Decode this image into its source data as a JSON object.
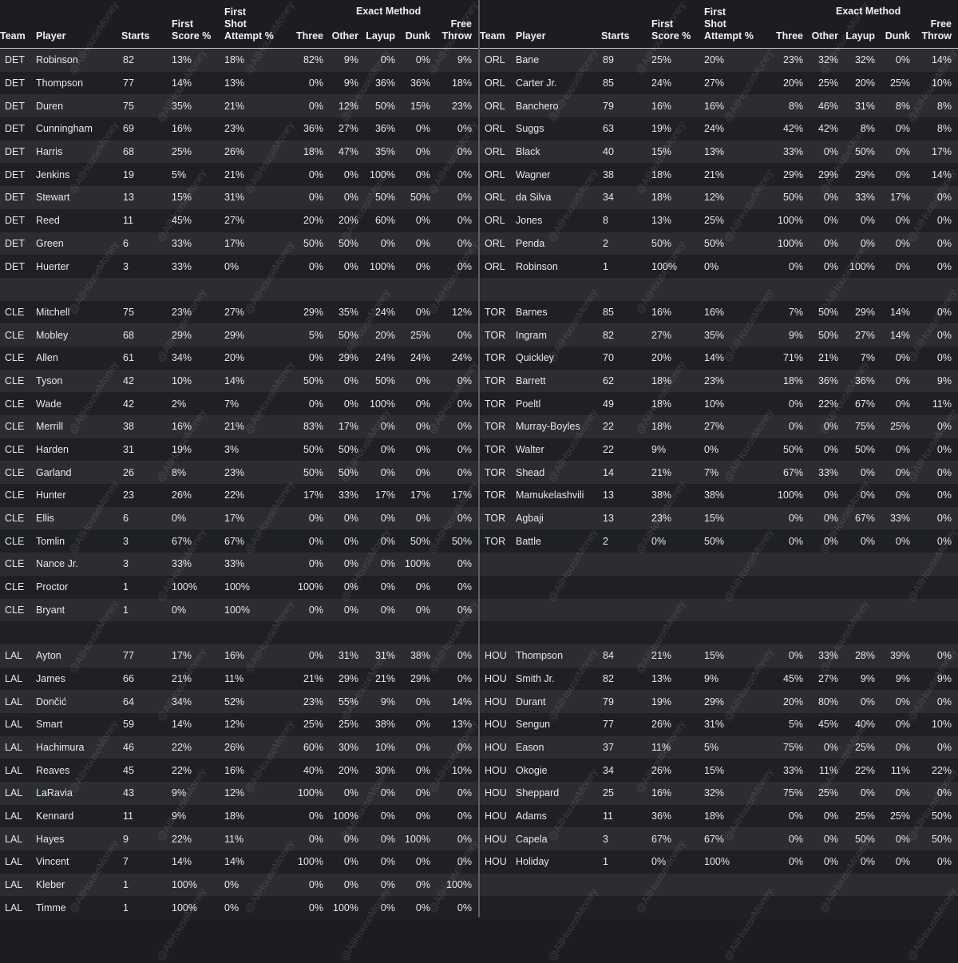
{
  "headers": {
    "team": "Team",
    "player": "Player",
    "starts": "Starts",
    "first_score_a": "First",
    "first_score_b": "Score %",
    "first_shot_a": "First",
    "first_shot_b": "Shot",
    "first_shot_c": "Attempt %",
    "exact_method": "Exact Method",
    "three": "Three",
    "other": "Other",
    "layup": "Layup",
    "dunk": "Dunk",
    "free_a": "Free",
    "free_b": "Throw"
  },
  "watermark": "@AllHouseMoney",
  "left_rows": [
    [
      "DET",
      "Robinson",
      "82",
      "13%",
      "18%",
      "82%",
      "9%",
      "0%",
      "0%",
      "9%"
    ],
    [
      "DET",
      "Thompson",
      "77",
      "14%",
      "13%",
      "0%",
      "9%",
      "36%",
      "36%",
      "18%"
    ],
    [
      "DET",
      "Duren",
      "75",
      "35%",
      "21%",
      "0%",
      "12%",
      "50%",
      "15%",
      "23%"
    ],
    [
      "DET",
      "Cunningham",
      "69",
      "16%",
      "23%",
      "36%",
      "27%",
      "36%",
      "0%",
      "0%"
    ],
    [
      "DET",
      "Harris",
      "68",
      "25%",
      "26%",
      "18%",
      "47%",
      "35%",
      "0%",
      "0%"
    ],
    [
      "DET",
      "Jenkins",
      "19",
      "5%",
      "21%",
      "0%",
      "0%",
      "100%",
      "0%",
      "0%"
    ],
    [
      "DET",
      "Stewart",
      "13",
      "15%",
      "31%",
      "0%",
      "0%",
      "50%",
      "50%",
      "0%"
    ],
    [
      "DET",
      "Reed",
      "11",
      "45%",
      "27%",
      "20%",
      "20%",
      "60%",
      "0%",
      "0%"
    ],
    [
      "DET",
      "Green",
      "6",
      "33%",
      "17%",
      "50%",
      "50%",
      "0%",
      "0%",
      "0%"
    ],
    [
      "DET",
      "Huerter",
      "3",
      "33%",
      "0%",
      "0%",
      "0%",
      "100%",
      "0%",
      "0%"
    ],
    [
      "",
      "",
      "",
      "",
      "",
      "",
      "",
      "",
      "",
      ""
    ],
    [
      "CLE",
      "Mitchell",
      "75",
      "23%",
      "27%",
      "29%",
      "35%",
      "24%",
      "0%",
      "12%"
    ],
    [
      "CLE",
      "Mobley",
      "68",
      "29%",
      "29%",
      "5%",
      "50%",
      "20%",
      "25%",
      "0%"
    ],
    [
      "CLE",
      "Allen",
      "61",
      "34%",
      "20%",
      "0%",
      "29%",
      "24%",
      "24%",
      "24%"
    ],
    [
      "CLE",
      "Tyson",
      "42",
      "10%",
      "14%",
      "50%",
      "0%",
      "50%",
      "0%",
      "0%"
    ],
    [
      "CLE",
      "Wade",
      "42",
      "2%",
      "7%",
      "0%",
      "0%",
      "100%",
      "0%",
      "0%"
    ],
    [
      "CLE",
      "Merrill",
      "38",
      "16%",
      "21%",
      "83%",
      "17%",
      "0%",
      "0%",
      "0%"
    ],
    [
      "CLE",
      "Harden",
      "31",
      "19%",
      "3%",
      "50%",
      "50%",
      "0%",
      "0%",
      "0%"
    ],
    [
      "CLE",
      "Garland",
      "26",
      "8%",
      "23%",
      "50%",
      "50%",
      "0%",
      "0%",
      "0%"
    ],
    [
      "CLE",
      "Hunter",
      "23",
      "26%",
      "22%",
      "17%",
      "33%",
      "17%",
      "17%",
      "17%"
    ],
    [
      "CLE",
      "Ellis",
      "6",
      "0%",
      "17%",
      "0%",
      "0%",
      "0%",
      "0%",
      "0%"
    ],
    [
      "CLE",
      "Tomlin",
      "3",
      "67%",
      "67%",
      "0%",
      "0%",
      "0%",
      "50%",
      "50%"
    ],
    [
      "CLE",
      "Nance Jr.",
      "3",
      "33%",
      "33%",
      "0%",
      "0%",
      "0%",
      "100%",
      "0%"
    ],
    [
      "CLE",
      "Proctor",
      "1",
      "100%",
      "100%",
      "100%",
      "0%",
      "0%",
      "0%",
      "0%"
    ],
    [
      "CLE",
      "Bryant",
      "1",
      "0%",
      "100%",
      "0%",
      "0%",
      "0%",
      "0%",
      "0%"
    ],
    [
      "",
      "",
      "",
      "",
      "",
      "",
      "",
      "",
      "",
      ""
    ],
    [
      "LAL",
      "Ayton",
      "77",
      "17%",
      "16%",
      "0%",
      "31%",
      "31%",
      "38%",
      "0%"
    ],
    [
      "LAL",
      "James",
      "66",
      "21%",
      "11%",
      "21%",
      "29%",
      "21%",
      "29%",
      "0%"
    ],
    [
      "LAL",
      "Dončić",
      "64",
      "34%",
      "52%",
      "23%",
      "55%",
      "9%",
      "0%",
      "14%"
    ],
    [
      "LAL",
      "Smart",
      "59",
      "14%",
      "12%",
      "25%",
      "25%",
      "38%",
      "0%",
      "13%"
    ],
    [
      "LAL",
      "Hachimura",
      "46",
      "22%",
      "26%",
      "60%",
      "30%",
      "10%",
      "0%",
      "0%"
    ],
    [
      "LAL",
      "Reaves",
      "45",
      "22%",
      "16%",
      "40%",
      "20%",
      "30%",
      "0%",
      "10%"
    ],
    [
      "LAL",
      "LaRavia",
      "43",
      "9%",
      "12%",
      "100%",
      "0%",
      "0%",
      "0%",
      "0%"
    ],
    [
      "LAL",
      "Kennard",
      "11",
      "9%",
      "18%",
      "0%",
      "100%",
      "0%",
      "0%",
      "0%"
    ],
    [
      "LAL",
      "Hayes",
      "9",
      "22%",
      "11%",
      "0%",
      "0%",
      "0%",
      "100%",
      "0%"
    ],
    [
      "LAL",
      "Vincent",
      "7",
      "14%",
      "14%",
      "100%",
      "0%",
      "0%",
      "0%",
      "0%"
    ],
    [
      "LAL",
      "Kleber",
      "1",
      "100%",
      "0%",
      "0%",
      "0%",
      "0%",
      "0%",
      "100%"
    ],
    [
      "LAL",
      "Timme",
      "1",
      "100%",
      "0%",
      "0%",
      "100%",
      "0%",
      "0%",
      "0%"
    ]
  ],
  "right_rows": [
    [
      "ORL",
      "Bane",
      "89",
      "25%",
      "20%",
      "23%",
      "32%",
      "32%",
      "0%",
      "14%"
    ],
    [
      "ORL",
      "Carter Jr.",
      "85",
      "24%",
      "27%",
      "20%",
      "25%",
      "20%",
      "25%",
      "10%"
    ],
    [
      "ORL",
      "Banchero",
      "79",
      "16%",
      "16%",
      "8%",
      "46%",
      "31%",
      "8%",
      "8%"
    ],
    [
      "ORL",
      "Suggs",
      "63",
      "19%",
      "24%",
      "42%",
      "42%",
      "8%",
      "0%",
      "8%"
    ],
    [
      "ORL",
      "Black",
      "40",
      "15%",
      "13%",
      "33%",
      "0%",
      "50%",
      "0%",
      "17%"
    ],
    [
      "ORL",
      "Wagner",
      "38",
      "18%",
      "21%",
      "29%",
      "29%",
      "29%",
      "0%",
      "14%"
    ],
    [
      "ORL",
      "da Silva",
      "34",
      "18%",
      "12%",
      "50%",
      "0%",
      "33%",
      "17%",
      "0%"
    ],
    [
      "ORL",
      "Jones",
      "8",
      "13%",
      "25%",
      "100%",
      "0%",
      "0%",
      "0%",
      "0%"
    ],
    [
      "ORL",
      "Penda",
      "2",
      "50%",
      "50%",
      "100%",
      "0%",
      "0%",
      "0%",
      "0%"
    ],
    [
      "ORL",
      "Robinson",
      "1",
      "100%",
      "0%",
      "0%",
      "0%",
      "100%",
      "0%",
      "0%"
    ],
    [
      "",
      "",
      "",
      "",
      "",
      "",
      "",
      "",
      "",
      ""
    ],
    [
      "TOR",
      "Barnes",
      "85",
      "16%",
      "16%",
      "7%",
      "50%",
      "29%",
      "14%",
      "0%"
    ],
    [
      "TOR",
      "Ingram",
      "82",
      "27%",
      "35%",
      "9%",
      "50%",
      "27%",
      "14%",
      "0%"
    ],
    [
      "TOR",
      "Quickley",
      "70",
      "20%",
      "14%",
      "71%",
      "21%",
      "7%",
      "0%",
      "0%"
    ],
    [
      "TOR",
      "Barrett",
      "62",
      "18%",
      "23%",
      "18%",
      "36%",
      "36%",
      "0%",
      "9%"
    ],
    [
      "TOR",
      "Poeltl",
      "49",
      "18%",
      "10%",
      "0%",
      "22%",
      "67%",
      "0%",
      "11%"
    ],
    [
      "TOR",
      "Murray-Boyles",
      "22",
      "18%",
      "27%",
      "0%",
      "0%",
      "75%",
      "25%",
      "0%"
    ],
    [
      "TOR",
      "Walter",
      "22",
      "9%",
      "0%",
      "50%",
      "0%",
      "50%",
      "0%",
      "0%"
    ],
    [
      "TOR",
      "Shead",
      "14",
      "21%",
      "7%",
      "67%",
      "33%",
      "0%",
      "0%",
      "0%"
    ],
    [
      "TOR",
      "Mamukelashvili",
      "13",
      "38%",
      "38%",
      "100%",
      "0%",
      "0%",
      "0%",
      "0%"
    ],
    [
      "TOR",
      "Agbaji",
      "13",
      "23%",
      "15%",
      "0%",
      "0%",
      "67%",
      "33%",
      "0%"
    ],
    [
      "TOR",
      "Battle",
      "2",
      "0%",
      "50%",
      "0%",
      "0%",
      "0%",
      "0%",
      "0%"
    ],
    [
      "",
      "",
      "",
      "",
      "",
      "",
      "",
      "",
      "",
      ""
    ],
    [
      "",
      "",
      "",
      "",
      "",
      "",
      "",
      "",
      "",
      ""
    ],
    [
      "",
      "",
      "",
      "",
      "",
      "",
      "",
      "",
      "",
      ""
    ],
    [
      "",
      "",
      "",
      "",
      "",
      "",
      "",
      "",
      "",
      ""
    ],
    [
      "HOU",
      "Thompson",
      "84",
      "21%",
      "15%",
      "0%",
      "33%",
      "28%",
      "39%",
      "0%"
    ],
    [
      "HOU",
      "Smith Jr.",
      "82",
      "13%",
      "9%",
      "45%",
      "27%",
      "9%",
      "9%",
      "9%"
    ],
    [
      "HOU",
      "Durant",
      "79",
      "19%",
      "29%",
      "20%",
      "80%",
      "0%",
      "0%",
      "0%"
    ],
    [
      "HOU",
      "Sengun",
      "77",
      "26%",
      "31%",
      "5%",
      "45%",
      "40%",
      "0%",
      "10%"
    ],
    [
      "HOU",
      "Eason",
      "37",
      "11%",
      "5%",
      "75%",
      "0%",
      "25%",
      "0%",
      "0%"
    ],
    [
      "HOU",
      "Okogie",
      "34",
      "26%",
      "15%",
      "33%",
      "11%",
      "22%",
      "11%",
      "22%"
    ],
    [
      "HOU",
      "Sheppard",
      "25",
      "16%",
      "32%",
      "75%",
      "25%",
      "0%",
      "0%",
      "0%"
    ],
    [
      "HOU",
      "Adams",
      "11",
      "36%",
      "18%",
      "0%",
      "0%",
      "25%",
      "25%",
      "50%"
    ],
    [
      "HOU",
      "Capela",
      "3",
      "67%",
      "67%",
      "0%",
      "0%",
      "50%",
      "0%",
      "50%"
    ],
    [
      "HOU",
      "Holiday",
      "1",
      "0%",
      "100%",
      "0%",
      "0%",
      "0%",
      "0%",
      "0%"
    ],
    [
      "",
      "",
      "",
      "",
      "",
      "",
      "",
      "",
      "",
      ""
    ],
    [
      "",
      "",
      "",
      "",
      "",
      "",
      "",
      "",
      "",
      ""
    ]
  ]
}
